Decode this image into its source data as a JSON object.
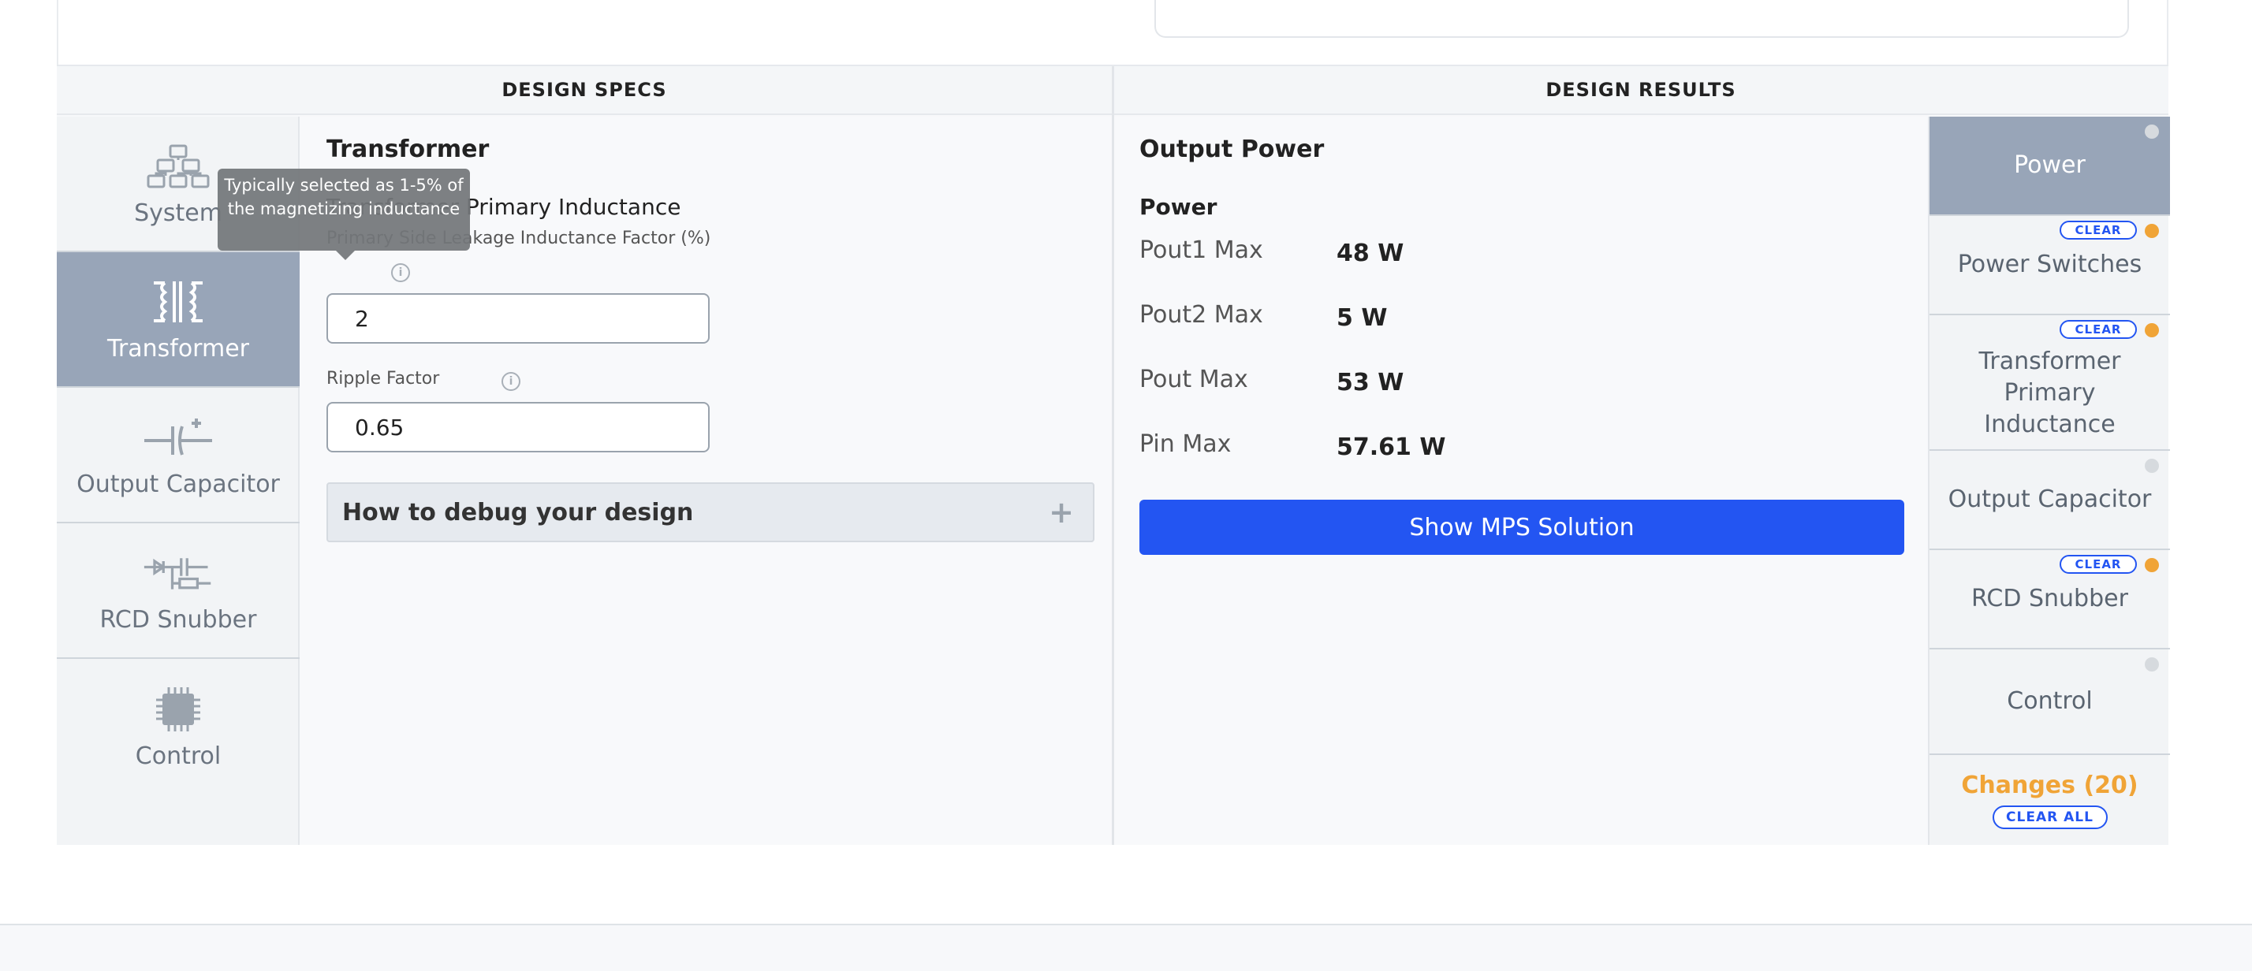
{
  "headers": {
    "specs": "DESIGN SPECS",
    "results": "DESIGN RESULTS"
  },
  "left_nav": [
    {
      "label": "System",
      "icon": "system-hierarchy-icon",
      "active": false
    },
    {
      "label": "Transformer",
      "icon": "transformer-icon",
      "active": true
    },
    {
      "label": "Output Capacitor",
      "icon": "capacitor-icon",
      "active": false
    },
    {
      "label": "RCD Snubber",
      "icon": "snubber-icon",
      "active": false
    },
    {
      "label": "Control",
      "icon": "chip-icon",
      "active": false
    }
  ],
  "spec": {
    "section_title": "Transformer",
    "subsection_title": "Transformer Primary Inductance",
    "field1_label": "Primary Side Leakage Inductance Factor (%)",
    "field1_value": "2",
    "field2_label": "Ripple Factor",
    "field2_value": "0.65",
    "accordion_label": "How to debug your design",
    "tooltip_text": "Typically selected as 1-5% of the magnetizing inductance"
  },
  "results": {
    "section_title": "Output Power",
    "subsection_title": "Power",
    "rows": [
      {
        "label": "Pout1 Max",
        "value": "48 W"
      },
      {
        "label": "Pout2 Max",
        "value": "5 W"
      },
      {
        "label": "Pout Max",
        "value": "53 W"
      },
      {
        "label": "Pin Max",
        "value": "57.61 W"
      }
    ],
    "button_label": "Show MPS Solution"
  },
  "right_nav": [
    {
      "label": "Power",
      "status": "grey",
      "clear": false,
      "active": true
    },
    {
      "label": "Power Switches",
      "status": "orange",
      "clear": true,
      "active": false
    },
    {
      "label": "Transformer Primary Inductance",
      "status": "orange",
      "clear": true,
      "active": false
    },
    {
      "label": "Output Capacitor",
      "status": "grey",
      "clear": false,
      "active": false
    },
    {
      "label": "RCD Snubber",
      "status": "orange",
      "clear": true,
      "active": false
    },
    {
      "label": "Control",
      "status": "grey",
      "clear": false,
      "active": false
    }
  ],
  "clear_label": "CLEAR",
  "changes": {
    "label": "Changes (20)",
    "clear_all": "CLEAR ALL"
  },
  "colors": {
    "accent": "#2355f2",
    "active_nav": "#98a5b8",
    "changed": "#f0a437",
    "unchanged": "#d6dade"
  }
}
